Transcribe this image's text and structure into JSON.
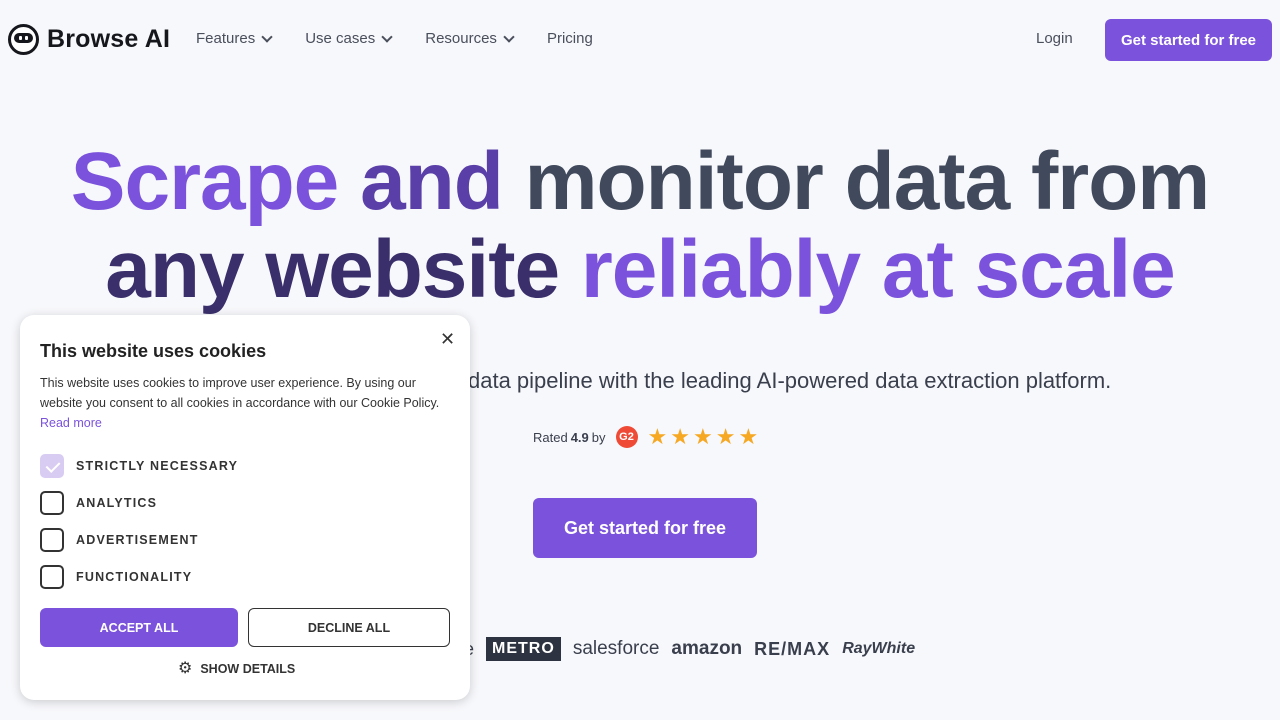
{
  "nav": {
    "logo_text": "Browse AI",
    "links": [
      "Features",
      "Use cases",
      "Resources",
      "Pricing"
    ],
    "login": "Login",
    "cta": "Get started for free"
  },
  "hero": {
    "line1_a": "Scrape",
    "line1_b": " and ",
    "line1_c": "monitor data from",
    "line2_a": "any website ",
    "line2_b": "reliably at scale",
    "subtitle": "data pipeline with the leading AI-powered data extraction platform.",
    "rating_prefix": "Rated",
    "rating_value": "4.9",
    "rating_by": "by",
    "rating_source": "G2",
    "stars": 5,
    "cta": "Get started for free"
  },
  "brands": [
    "ogle",
    "METRO",
    "salesforce",
    "amazon",
    "RE/MAX",
    "RayWhite"
  ],
  "cookie": {
    "title": "This website uses cookies",
    "body": "This website uses cookies to improve user experience. By using our website you consent to all cookies in accordance with our Cookie Policy.",
    "read_more": "Read more",
    "options": [
      {
        "label": "STRICTLY NECESSARY",
        "checked": true
      },
      {
        "label": "ANALYTICS",
        "checked": false
      },
      {
        "label": "ADVERTISEMENT",
        "checked": false
      },
      {
        "label": "FUNCTIONALITY",
        "checked": false
      }
    ],
    "accept": "ACCEPT ALL",
    "decline": "DECLINE ALL",
    "show_details": "SHOW DETAILS"
  },
  "colors": {
    "accent": "#7b52dc",
    "star": "#f6a823",
    "g2": "#ef4a36"
  }
}
